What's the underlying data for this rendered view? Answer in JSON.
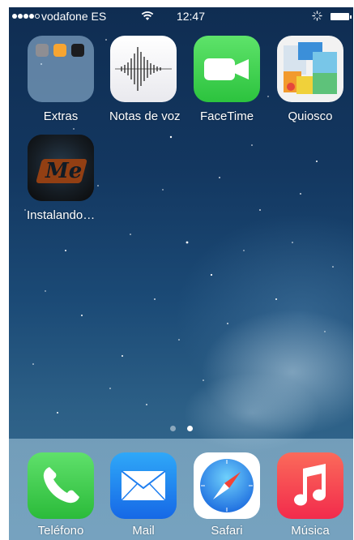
{
  "status_bar": {
    "carrier": "vodafone ES",
    "time": "12:47",
    "signal_bars_filled": 4,
    "signal_bars_total": 5,
    "battery_level": 1.0
  },
  "home": {
    "apps": [
      {
        "label": "Extras",
        "icon": "folder-icon"
      },
      {
        "label": "Notas de voz",
        "icon": "voice-memos-icon"
      },
      {
        "label": "FaceTime",
        "icon": "facetime-icon"
      },
      {
        "label": "Quiosco",
        "icon": "newsstand-icon"
      },
      {
        "label": "Instalando…",
        "icon": "installing-app-icon"
      }
    ],
    "page_count": 2,
    "current_page": 2
  },
  "dock": {
    "apps": [
      {
        "label": "Teléfono",
        "icon": "phone-icon"
      },
      {
        "label": "Mail",
        "icon": "mail-icon"
      },
      {
        "label": "Safari",
        "icon": "safari-icon"
      },
      {
        "label": "Música",
        "icon": "music-icon"
      }
    ]
  },
  "colors": {
    "wallpaper_top": "#0f2d52",
    "facetime_green": "#4cd964",
    "phone_green": "#3fcf4a",
    "mail_blue": "#1e7ef0",
    "music_red": "#f43b4e"
  }
}
